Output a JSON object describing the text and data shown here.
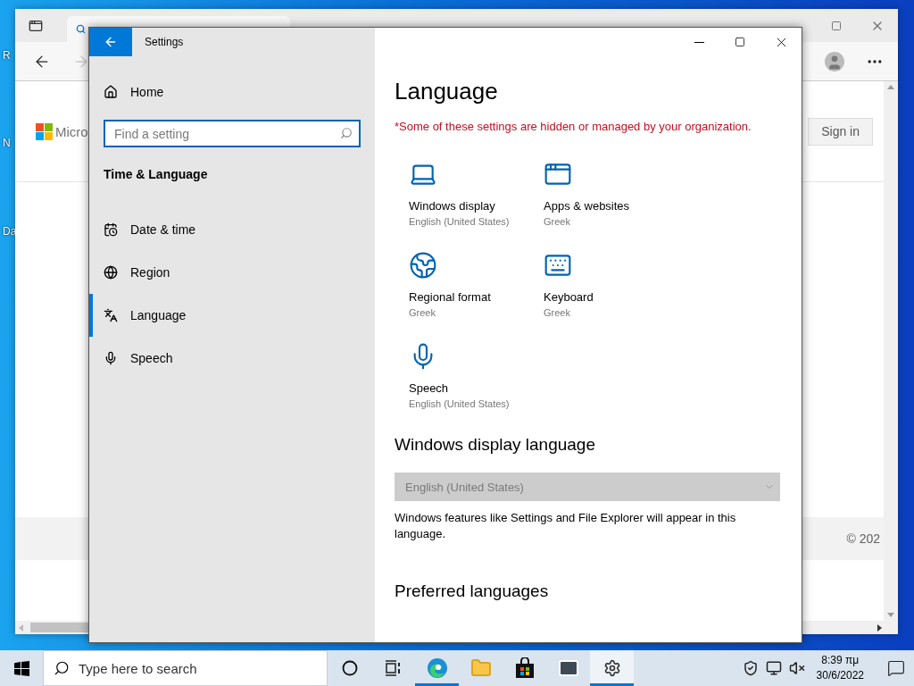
{
  "desktop": {
    "icon_labels": [
      "R",
      "N",
      "Da"
    ]
  },
  "browser": {
    "back": {
      "disabled": false
    },
    "forward": {
      "disabled": true
    },
    "logo_text": "Micro",
    "sign_in": "Sign in",
    "footer_text": "© 202"
  },
  "settings": {
    "title": "Settings",
    "nav": {
      "home": "Home",
      "search_placeholder": "Find a setting",
      "section": "Time & Language",
      "items": [
        {
          "label": "Date & time",
          "selected": false
        },
        {
          "label": "Region",
          "selected": false
        },
        {
          "label": "Language",
          "selected": true
        },
        {
          "label": "Speech",
          "selected": false
        }
      ]
    },
    "page": {
      "heading": "Language",
      "notice": "*Some of these settings are hidden or managed by your organization.",
      "tiles": [
        {
          "title": "Windows display",
          "value": "English (United States)"
        },
        {
          "title": "Apps & websites",
          "value": "Greek"
        },
        {
          "title": "Regional format",
          "value": "Greek"
        },
        {
          "title": "Keyboard",
          "value": "Greek"
        },
        {
          "title": "Speech",
          "value": "English (United States)"
        }
      ],
      "display_language": {
        "heading": "Windows display language",
        "dropdown": {
          "value": "English (United States)",
          "disabled": true
        },
        "description": "Windows features like Settings and File Explorer will appear in this language."
      },
      "preferred_heading": "Preferred languages"
    }
  },
  "taskbar": {
    "search_placeholder": "Type here to search",
    "apps": [
      {
        "running": false,
        "active": false
      },
      {
        "running": false,
        "active": false
      },
      {
        "running": true,
        "active": false
      },
      {
        "running": false,
        "active": false
      },
      {
        "running": false,
        "active": false
      },
      {
        "running": false,
        "active": false
      },
      {
        "running": true,
        "active": true
      }
    ],
    "clock": {
      "time": "8:39 πμ",
      "date": "30/6/2022"
    }
  }
}
